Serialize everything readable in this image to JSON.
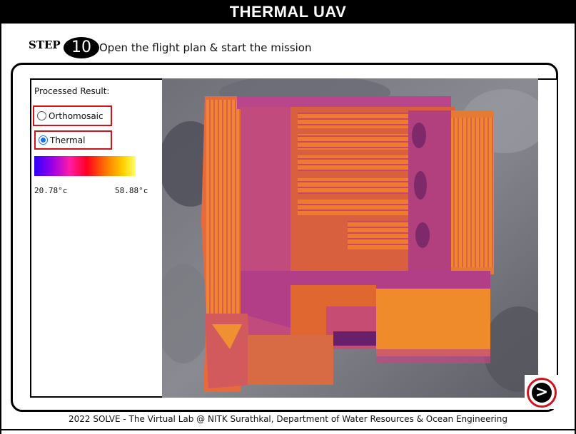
{
  "header": {
    "title": "THERMAL UAV"
  },
  "step": {
    "label": "STEP",
    "number": "10",
    "instruction": "Open the flight plan & start the mission"
  },
  "panel": {
    "result_label": "Processed Result:",
    "options": [
      {
        "label": "Orthomosaic",
        "selected": false
      },
      {
        "label": "Thermal",
        "selected": true
      }
    ],
    "temperature_scale": {
      "min_label": "20.78°c",
      "max_label": "58.88°c",
      "colors": [
        "#2d00ff",
        "#9b00e8",
        "#ff1ba5",
        "#ff0020",
        "#ff7d00",
        "#ffd200",
        "#ffff6a"
      ]
    }
  },
  "map": {
    "view": "thermal",
    "icon": "thermal-map-image"
  },
  "navigation": {
    "next_symbol": ">",
    "icon": "next-arrow-icon"
  },
  "footer": {
    "text": "2022 SOLVE - The Virtual Lab @ NITK Surathkal, Department of Water Resources & Ocean Engineering"
  }
}
